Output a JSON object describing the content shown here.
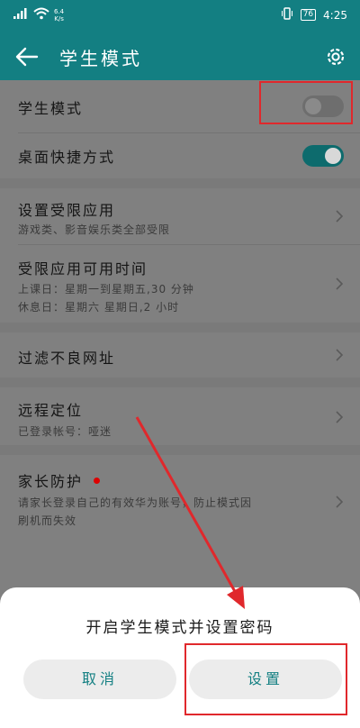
{
  "status_bar": {
    "speed_top": "6.4",
    "speed_bottom": "K/s",
    "battery": "76",
    "time": "4:25"
  },
  "header": {
    "title": "学生模式"
  },
  "rows": {
    "student_mode": {
      "label": "学生模式",
      "enabled": false
    },
    "desktop_shortcut": {
      "label": "桌面快捷方式",
      "enabled": true
    },
    "restricted_apps": {
      "label": "设置受限应用",
      "sub": "游戏类、影音娱乐类全部受限"
    },
    "available_time": {
      "label": "受限应用可用时间",
      "sub1": "上课日：星期一到星期五,30 分钟",
      "sub2": "休息日：星期六 星期日,2 小时"
    },
    "filter": {
      "label": "过滤不良网址"
    },
    "remote_locate": {
      "label": "远程定位",
      "sub": "已登录帐号：哑迷"
    },
    "parent_protect": {
      "label": "家长防护",
      "sub1": "请家长登录自己的有效华为账号，防止模式因",
      "sub2": "刷机而失效"
    }
  },
  "dialog": {
    "title": "开启学生模式并设置密码",
    "cancel": "取消",
    "confirm": "设置"
  },
  "colors": {
    "accent": "#137f82",
    "annotation": "#e0282c"
  }
}
